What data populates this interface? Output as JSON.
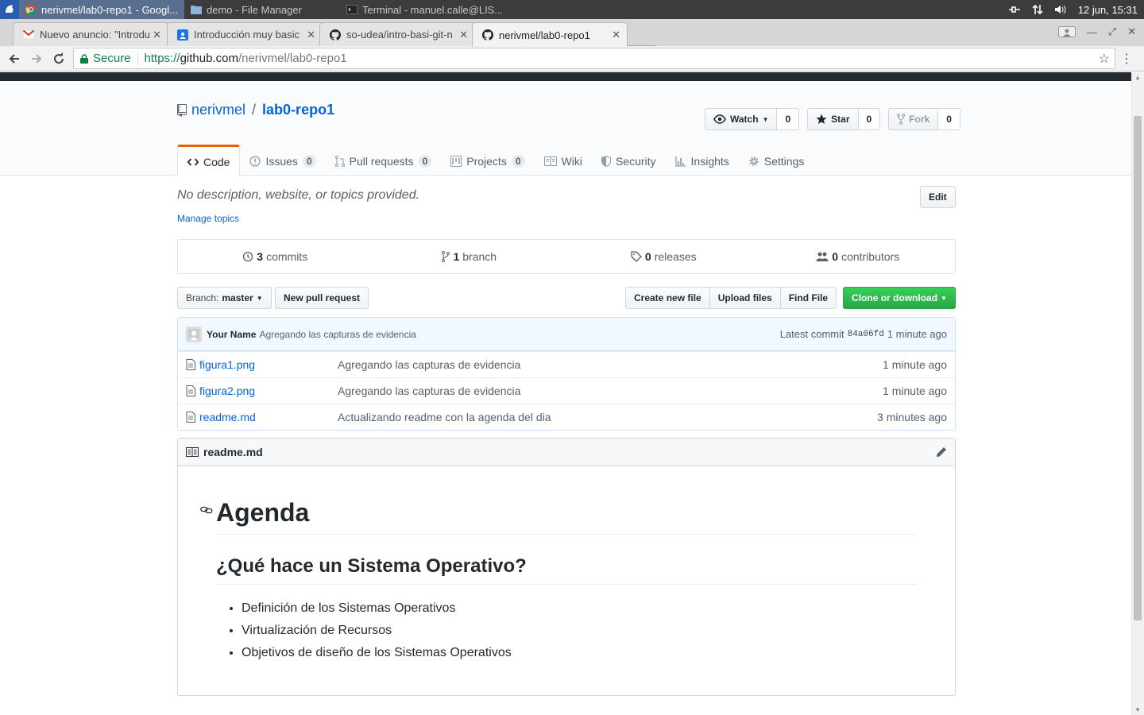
{
  "taskbar": {
    "windows": [
      "nerivmel/lab0-repo1 - Googl...",
      "demo - File Manager",
      "Terminal - manuel.calle@LIS..."
    ],
    "clock": "12 jun, 15:31"
  },
  "browser": {
    "tabs": [
      {
        "title": "Nuevo anuncio: \"Introdu"
      },
      {
        "title": "Introducción muy basic"
      },
      {
        "title": "so-udea/intro-basi-git-n"
      },
      {
        "title": "nerivmel/lab0-repo1"
      }
    ],
    "secure_label": "Secure",
    "url": {
      "scheme": "https://",
      "host": "github.com",
      "path": "/nerivmel/lab0-repo1"
    }
  },
  "repo": {
    "owner": "nerivmel",
    "separator": "/",
    "name": "lab0-repo1",
    "watch_label": "Watch",
    "watch_count": "0",
    "star_label": "Star",
    "star_count": "0",
    "fork_label": "Fork",
    "fork_count": "0"
  },
  "nav": {
    "code": "Code",
    "issues": "Issues",
    "issues_count": "0",
    "pulls": "Pull requests",
    "pulls_count": "0",
    "projects": "Projects",
    "projects_count": "0",
    "wiki": "Wiki",
    "security": "Security",
    "insights": "Insights",
    "settings": "Settings"
  },
  "about": {
    "description": "No description, website, or topics provided.",
    "manage_topics": "Manage topics",
    "edit_label": "Edit"
  },
  "summary": {
    "commits_num": "3",
    "commits_label": "commits",
    "branch_num": "1",
    "branch_label": "branch",
    "releases_num": "0",
    "releases_label": "releases",
    "contributors_num": "0",
    "contributors_label": "contributors"
  },
  "filenav": {
    "branch_prefix": "Branch:",
    "branch_name": "master",
    "new_pr": "New pull request",
    "create_file": "Create new file",
    "upload_files": "Upload files",
    "find_file": "Find File",
    "clone": "Clone or download"
  },
  "commit": {
    "author": "Your Name",
    "message": "Agregando las capturas de evidencia",
    "latest_label": "Latest commit",
    "sha": "84a06fd",
    "age": "1 minute ago"
  },
  "files": [
    {
      "name": "figura1.png",
      "message": "Agregando las capturas de evidencia",
      "age": "1 minute ago"
    },
    {
      "name": "figura2.png",
      "message": "Agregando las capturas de evidencia",
      "age": "1 minute ago"
    },
    {
      "name": "readme.md",
      "message": "Actualizando readme con la agenda del dia",
      "age": "3 minutes ago"
    }
  ],
  "readme": {
    "filename": "readme.md",
    "h1": "Agenda",
    "h2": "¿Qué hace un Sistema Operativo?",
    "items": [
      "Definición de los Sistemas Operativos",
      "Virtualización de Recursos",
      "Objetivos de diseño de los Sistemas Operativos"
    ]
  }
}
